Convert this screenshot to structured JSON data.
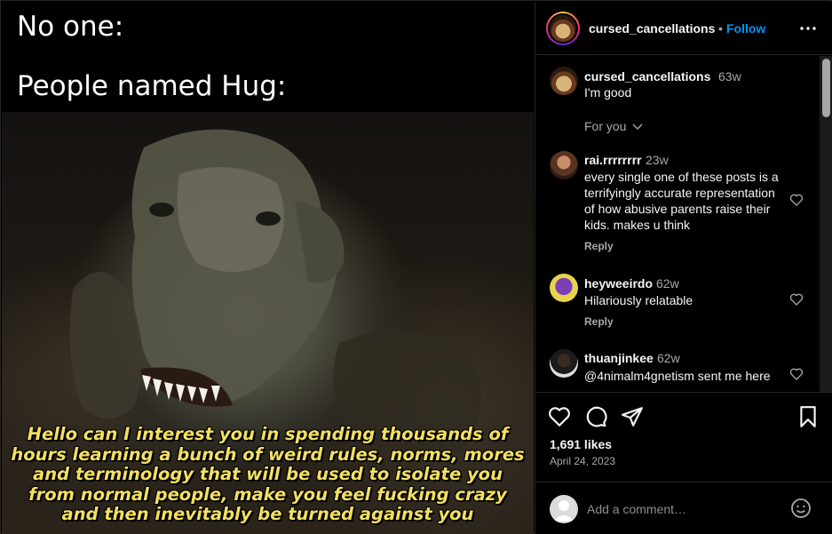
{
  "meme": {
    "line1": "No one:",
    "line2": "People named Hug:",
    "caption": "Hello can I interest you in spending thousands of hours learning a bunch of weird rules, norms, mores and terminology that will be used to isolate you from normal people, make you feel fucking crazy and then inevitably be turned against you"
  },
  "header": {
    "username": "cursed_cancellations",
    "separator": "•",
    "follow_label": "Follow",
    "more_icon": "more-horizontal-icon"
  },
  "caption_post": {
    "username": "cursed_cancellations",
    "time": "63w",
    "text": "I'm good",
    "for_you_label": "For you"
  },
  "comments": [
    {
      "username": "rai.rrrrrrrr",
      "time": "23w",
      "text": "every single one of these posts is a terrifyingly accurate representation of how abusive parents raise their kids. makes u think",
      "reply": "Reply"
    },
    {
      "username": "heyweeirdo",
      "time": "62w",
      "text": "Hilariously relatable",
      "reply": "Reply"
    },
    {
      "username": "thuanjinkee",
      "time": "62w",
      "text": "@4nimalm4gnetism sent me here",
      "reply": ""
    }
  ],
  "actions": {
    "icons": [
      "heart-icon",
      "comment-icon",
      "share-icon",
      "bookmark-icon"
    ],
    "likes": "1,691 likes",
    "date": "April 24, 2023"
  },
  "add_comment": {
    "placeholder": "Add a comment…",
    "emoji_icon": "emoji-icon"
  },
  "colors": {
    "accent": "#0095f6",
    "caption_yellow": "#f3df62",
    "secondary_text": "#a8a8a8"
  }
}
